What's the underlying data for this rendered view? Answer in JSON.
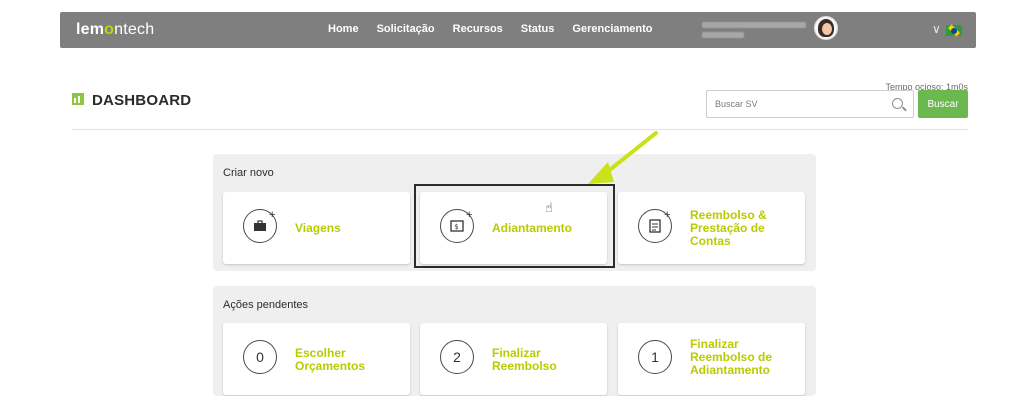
{
  "brand": {
    "logo_bold": "lem",
    "logo_o": "o",
    "logo_rest": "ntech"
  },
  "nav": {
    "items": [
      "Home",
      "Solicitação",
      "Recursos",
      "Status",
      "Gerenciamento"
    ]
  },
  "header": {
    "title": "DASHBOARD",
    "idle_text": "Tempo ocioso: 1m0s",
    "search_placeholder": "Buscar SV",
    "search_button": "Buscar"
  },
  "create_section": {
    "title": "Criar novo",
    "cards": [
      {
        "label": "Viagens",
        "icon": "luggage-icon"
      },
      {
        "label": "Adiantamento",
        "icon": "money-icon"
      },
      {
        "label": "Reembolso & Prestação de Contas",
        "lines": [
          "Reembolso &",
          "Prestação de",
          "Contas"
        ],
        "icon": "document-icon"
      }
    ]
  },
  "pending_section": {
    "title": "Ações pendentes",
    "cards": [
      {
        "count": "0",
        "lines": [
          "Escolher",
          "Orçamentos"
        ]
      },
      {
        "count": "2",
        "lines": [
          "Finalizar",
          "Reembolso"
        ]
      },
      {
        "count": "1",
        "lines": [
          "Finalizar",
          "Reembolso de",
          "Adiantamento"
        ]
      }
    ]
  },
  "colors": {
    "accent": "#b8cc00",
    "topbar": "#7f7f7f",
    "button": "#6ab84e",
    "arrow": "#c9e21a"
  }
}
